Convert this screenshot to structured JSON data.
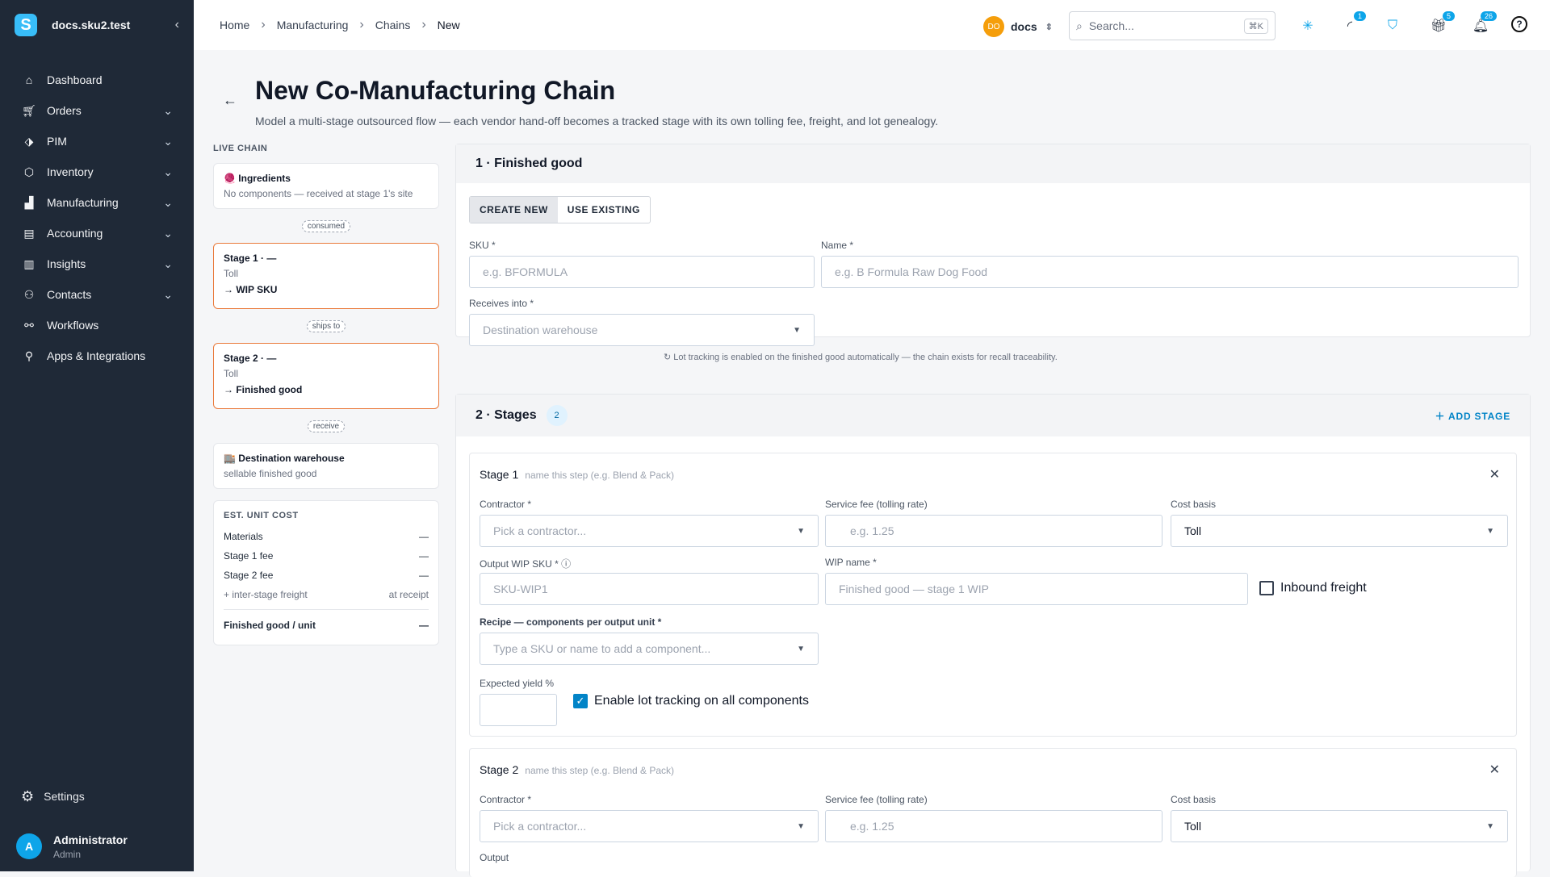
{
  "app": {
    "name": "docs.sku2.test",
    "logo_letter": "S",
    "collapse": "‹"
  },
  "nav": [
    {
      "label": "Dashboard",
      "icon": "home-icon"
    },
    {
      "label": "Orders",
      "icon": "cart-icon",
      "chev": true
    },
    {
      "label": "PIM",
      "icon": "tag-icon",
      "chev": true
    },
    {
      "label": "Inventory",
      "icon": "box-icon",
      "chev": true
    },
    {
      "label": "Manufacturing",
      "icon": "factory-icon",
      "chev": true
    },
    {
      "label": "Accounting",
      "icon": "book-icon",
      "chev": true
    },
    {
      "label": "Insights",
      "icon": "chart-icon",
      "chev": true
    },
    {
      "label": "Contacts",
      "icon": "people-icon",
      "chev": true
    },
    {
      "label": "Workflows",
      "icon": "workflow-icon"
    },
    {
      "label": "Apps & Integrations",
      "icon": "plug-icon"
    }
  ],
  "settings": "Settings",
  "user": {
    "initial": "A",
    "name": "Administrator",
    "role": "Admin"
  },
  "breadcrumb": [
    "Home",
    "Manufacturing",
    "Chains",
    "New"
  ],
  "org": {
    "badge": "DO",
    "name": "docs"
  },
  "search": {
    "placeholder": "Search...",
    "kbd": "⌘K"
  },
  "badges": {
    "activity": "1",
    "gift": "5",
    "bell": "26"
  },
  "page": {
    "title": "New Co-Manufacturing Chain",
    "subtitle": "Model a multi-stage outsourced flow — each vendor hand-off becomes a tracked stage with its own tolling fee, freight, and lot genealogy."
  },
  "live_chain": {
    "heading": "LIVE CHAIN",
    "ingredients": {
      "title": "🧶 Ingredients",
      "sub": "No components — received at stage 1's site"
    },
    "conn1": "consumed",
    "stage1": {
      "title": "Stage 1 · —",
      "sub": "Toll",
      "out": "→ WIP SKU"
    },
    "conn2": "ships to",
    "stage2": {
      "title": "Stage 2 · —",
      "sub": "Toll",
      "out": "→ Finished good"
    },
    "conn3": "receive",
    "dest": {
      "title": "🏬 Destination warehouse",
      "sub": "sellable finished good"
    }
  },
  "cost": {
    "heading": "EST. UNIT COST",
    "rows": [
      {
        "label": "Materials",
        "value": "—"
      },
      {
        "label": "Stage 1 fee",
        "value": "—"
      },
      {
        "label": "Stage 2 fee",
        "value": "—"
      },
      {
        "label": "+ inter-stage freight",
        "value": "at receipt"
      }
    ],
    "total_label": "Finished good / unit",
    "total_value": "—"
  },
  "finished": {
    "heading": "1 · Finished good",
    "create": "CREATE NEW",
    "use": "USE EXISTING",
    "sku_label": "SKU *",
    "sku_ph": "e.g. BFORMULA",
    "name_label": "Name *",
    "name_ph": "e.g. B Formula Raw Dog Food",
    "recv_label": "Receives into *",
    "recv_ph": "Destination warehouse",
    "note": "Lot tracking is enabled on the finished good automatically — the chain exists for recall traceability."
  },
  "stages": {
    "heading": "2 · Stages",
    "count": "2",
    "add": "ADD STAGE",
    "s1": {
      "title": "Stage 1",
      "hint": "name this step (e.g. Blend & Pack)",
      "contractor_label": "Contractor *",
      "contractor_ph": "Pick a contractor...",
      "fee_label": "Service fee (tolling rate)",
      "fee_ph": "e.g. 1.25",
      "basis_label": "Cost basis",
      "basis": "Toll",
      "wip_label": "Output WIP SKU *",
      "wip_ph": "SKU-WIP1",
      "wipname_label": "WIP name *",
      "wipname_ph": "Finished good — stage 1 WIP",
      "freight": "Inbound freight",
      "recipe_label": "Recipe — components per output unit *",
      "recipe_ph": "Type a SKU or name to add a component...",
      "yield_label": "Expected yield %",
      "lot": "Enable lot tracking on all components"
    },
    "s2": {
      "title": "Stage 2",
      "hint": "name this step (e.g. Blend & Pack)",
      "contractor_label": "Contractor *",
      "contractor_ph": "Pick a contractor...",
      "fee_label": "Service fee (tolling rate)",
      "fee_ph": "e.g. 1.25",
      "basis_label": "Cost basis",
      "basis": "Toll",
      "output_label": "Output"
    }
  }
}
